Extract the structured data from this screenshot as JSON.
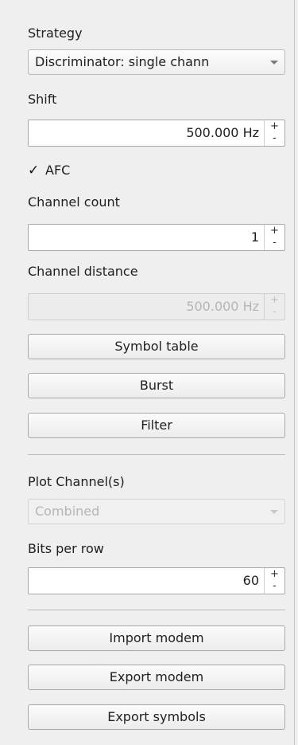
{
  "strategy": {
    "label": "Strategy",
    "selected": "Discriminator: single chann"
  },
  "shift": {
    "label": "Shift",
    "value": "500.000 Hz"
  },
  "afc": {
    "label": "AFC",
    "checked": true,
    "check_glyph": "✓"
  },
  "channel_count": {
    "label": "Channel count",
    "value": "1"
  },
  "channel_distance": {
    "label": "Channel distance",
    "value": "500.000 Hz",
    "enabled": false
  },
  "buttons": {
    "symbol_table": "Symbol table",
    "burst": "Burst",
    "filter": "Filter"
  },
  "plot_channels": {
    "label": "Plot Channel(s)",
    "selected": "Combined",
    "enabled": false
  },
  "bits_per_row": {
    "label": "Bits per row",
    "value": "60"
  },
  "modem_buttons": {
    "import_modem": "Import modem",
    "export_modem": "Export modem",
    "export_symbols": "Export symbols"
  },
  "spin_glyphs": {
    "up": "+",
    "down": "-"
  }
}
